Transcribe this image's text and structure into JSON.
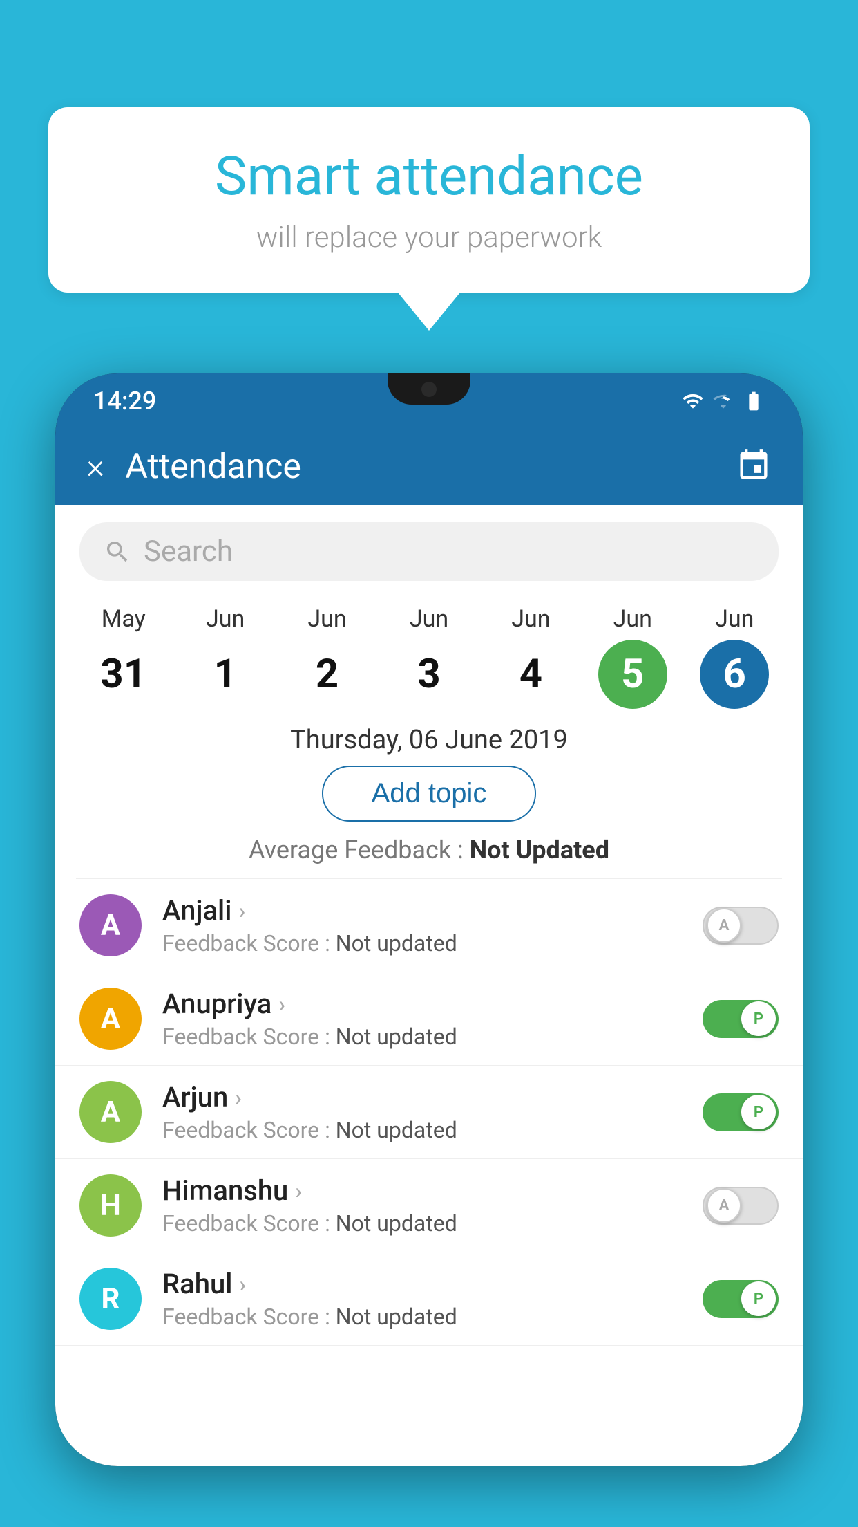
{
  "background": {
    "color": "#29b6d8"
  },
  "speech_bubble": {
    "title": "Smart attendance",
    "subtitle": "will replace your paperwork"
  },
  "phone": {
    "status_bar": {
      "time": "14:29"
    },
    "app_bar": {
      "title": "Attendance",
      "close_icon": "×",
      "calendar_icon": "calendar-icon"
    },
    "search": {
      "placeholder": "Search"
    },
    "calendar": {
      "days": [
        {
          "month": "May",
          "date": "31",
          "state": "normal"
        },
        {
          "month": "Jun",
          "date": "1",
          "state": "normal"
        },
        {
          "month": "Jun",
          "date": "2",
          "state": "normal"
        },
        {
          "month": "Jun",
          "date": "3",
          "state": "normal"
        },
        {
          "month": "Jun",
          "date": "4",
          "state": "normal"
        },
        {
          "month": "Jun",
          "date": "5",
          "state": "today"
        },
        {
          "month": "Jun",
          "date": "6",
          "state": "selected"
        }
      ]
    },
    "selected_date_label": "Thursday, 06 June 2019",
    "add_topic_label": "Add topic",
    "avg_feedback_label": "Average Feedback : ",
    "avg_feedback_value": "Not Updated",
    "students": [
      {
        "name": "Anjali",
        "avatar_letter": "A",
        "avatar_color": "#9b59b6",
        "feedback_label": "Feedback Score : ",
        "feedback_value": "Not updated",
        "toggle_state": "off",
        "toggle_letter": "A"
      },
      {
        "name": "Anupriya",
        "avatar_letter": "A",
        "avatar_color": "#f0a500",
        "feedback_label": "Feedback Score : ",
        "feedback_value": "Not updated",
        "toggle_state": "on",
        "toggle_letter": "P"
      },
      {
        "name": "Arjun",
        "avatar_letter": "A",
        "avatar_color": "#8bc34a",
        "feedback_label": "Feedback Score : ",
        "feedback_value": "Not updated",
        "toggle_state": "on",
        "toggle_letter": "P"
      },
      {
        "name": "Himanshu",
        "avatar_letter": "H",
        "avatar_color": "#8bc34a",
        "feedback_label": "Feedback Score : ",
        "feedback_value": "Not updated",
        "toggle_state": "off",
        "toggle_letter": "A"
      },
      {
        "name": "Rahul",
        "avatar_letter": "R",
        "avatar_color": "#26c6da",
        "feedback_label": "Feedback Score : ",
        "feedback_value": "Not updated",
        "toggle_state": "on",
        "toggle_letter": "P"
      }
    ]
  }
}
